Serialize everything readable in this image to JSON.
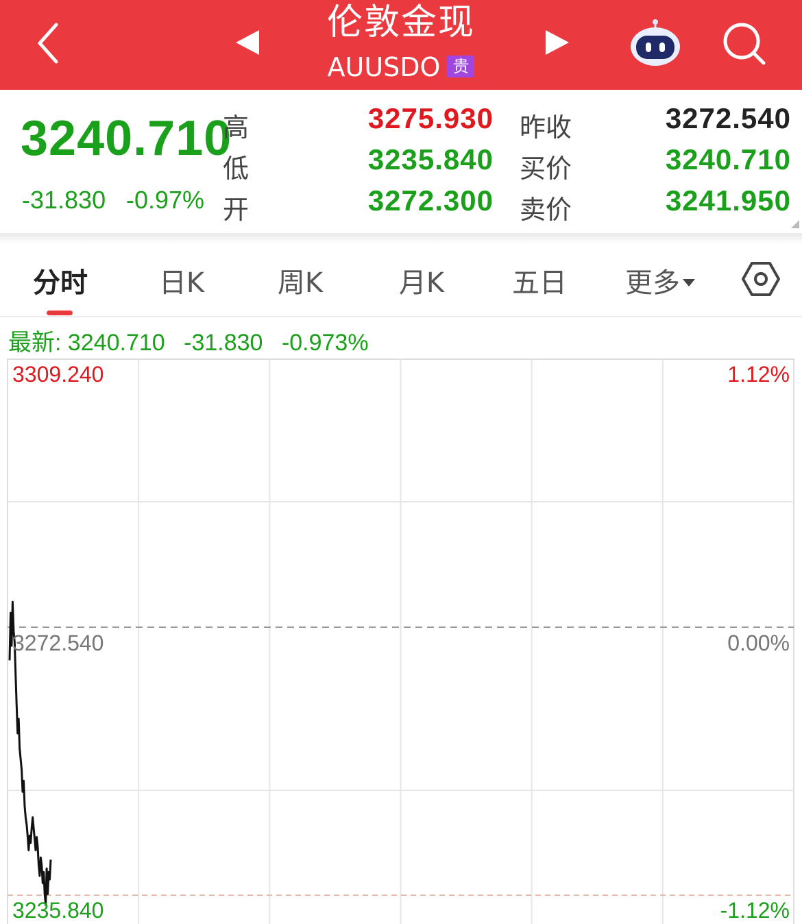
{
  "header": {
    "title": "伦敦金现",
    "symbol": "AUUSDO",
    "badge": "贵",
    "colors": {
      "bg": "#ea3a3f",
      "badge": "#a146e0"
    },
    "icons": [
      "back-icon",
      "prev-arrow-icon",
      "next-arrow-icon",
      "robot-assistant-icon",
      "search-icon"
    ]
  },
  "quote": {
    "last": "3240.710",
    "change": "-31.830",
    "change_pct": "-0.97%",
    "rows": [
      {
        "label": "高",
        "value": "3275.930",
        "label2": "昨收",
        "value2": "3272.540"
      },
      {
        "label": "低",
        "value": "3235.840",
        "label2": "买价",
        "value2": "3240.710"
      },
      {
        "label": "开",
        "value": "3272.300",
        "label2": "卖价",
        "value2": "3241.950"
      }
    ]
  },
  "tabs": [
    "分时",
    "日K",
    "周K",
    "月K",
    "五日",
    "更多"
  ],
  "active_tab": "分时",
  "info": {
    "latest_label": "最新: 3240.710",
    "change": "-31.830",
    "change_pct": "-0.973%"
  },
  "axis": {
    "top_price": "3309.240",
    "top_pct": "1.12%",
    "mid_price": "3272.540",
    "mid_pct": "0.00%",
    "bottom_price": "3235.840",
    "bottom_pct": "-1.12%"
  },
  "chart_data": {
    "type": "line",
    "title": "",
    "xlabel": "",
    "ylabel": "",
    "ylim": [
      3235.84,
      3309.24
    ],
    "reference": 3272.54,
    "grid": true,
    "series": [
      {
        "values": [
          3268.0,
          3274.5,
          3270.0,
          3276.0,
          3272.0,
          3270.5,
          3266.0,
          3262.0,
          3258.0,
          3260.0,
          3256.0,
          3254.5,
          3253.0,
          3250.0,
          3251.5,
          3248.0,
          3246.5,
          3245.5,
          3244.0,
          3242.0,
          3244.0,
          3243.0,
          3245.0,
          3246.5,
          3245.0,
          3243.5,
          3242.0,
          3243.8,
          3242.5,
          3240.0,
          3238.5,
          3241.0,
          3240.0,
          3237.5,
          3239.0,
          3236.0,
          3234.5,
          3239.5,
          3236.0,
          3239.0,
          3238.0,
          3240.71
        ]
      }
    ]
  }
}
